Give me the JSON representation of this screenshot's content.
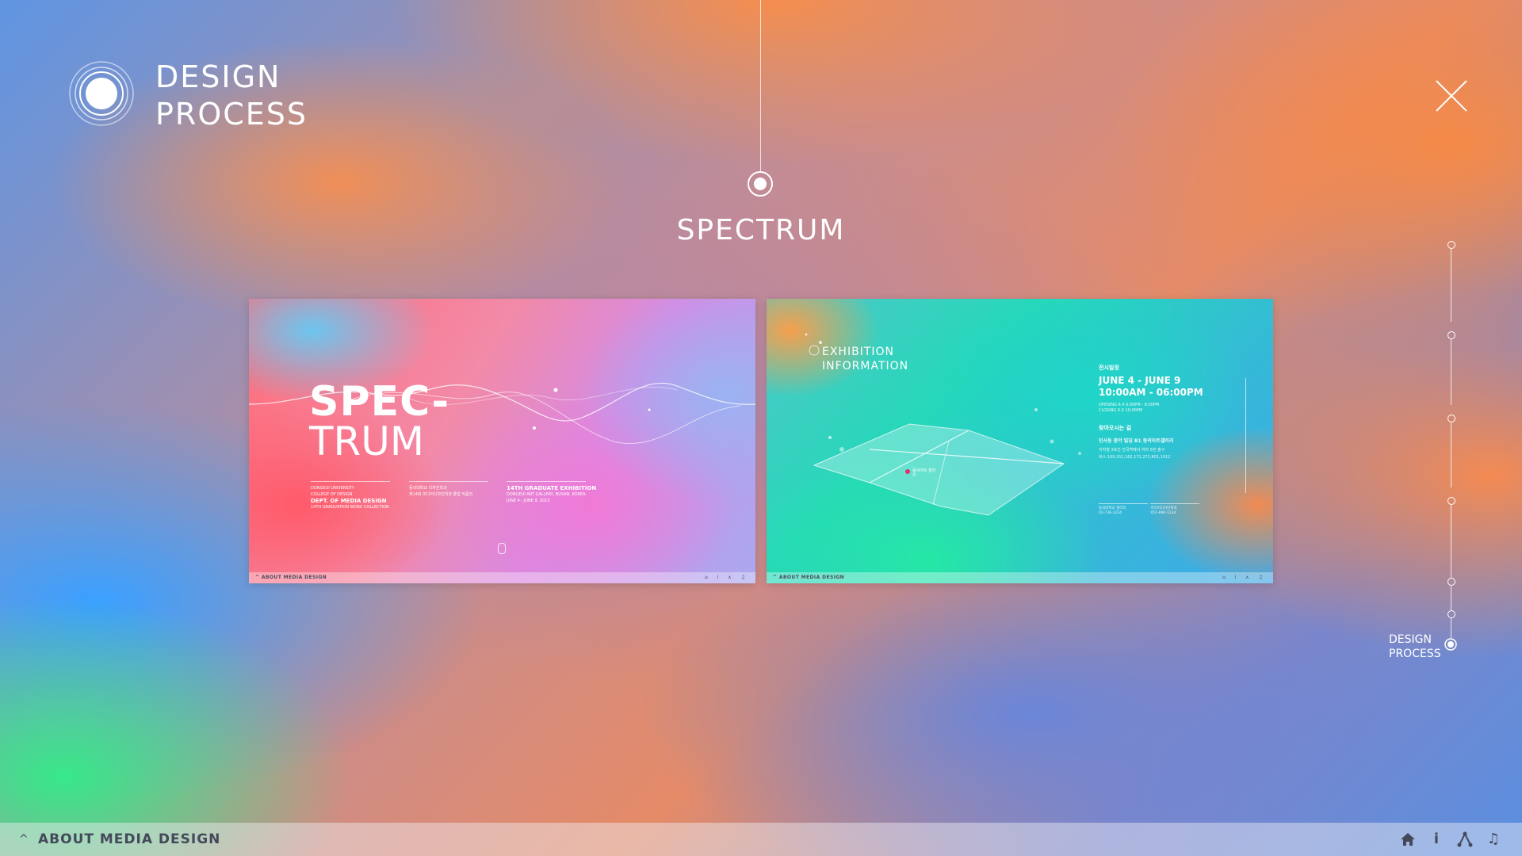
{
  "header": {
    "title_line1": "DESIGN",
    "title_line2": "PROCESS",
    "logo_icon": "ring-logo-icon",
    "close_icon": "close-icon"
  },
  "section": {
    "title": "SPECTRUM"
  },
  "cards": [
    {
      "spec": "SPEC-",
      "trum": "TRUM",
      "col1": [
        "DONGEUI UNIVERSITY",
        "COLLEGE OF DESIGN",
        "DEPT. OF MEDIA DESIGN",
        "14TH GRADUATION WORK COLLECTION"
      ],
      "col2": [
        "동의대학교 디자인학과",
        "제14회 미디어디자인학과 졸업 작품전"
      ],
      "col3": [
        "14TH GRADUATE EXHIBITION",
        "DONGEUI ART GALLERY, BUSAN, KOREA",
        "JUNE 4 - JUNE 9, 2015"
      ],
      "bar_label": "^ ABOUT MEDIA DESIGN",
      "bar_icons": "⌂ i ⋏ ♫"
    },
    {
      "title_line1": "EXHIBITION",
      "title_line2": "INFORMATION",
      "hdr1": "전시일정",
      "date1": "JUNE 4 - JUNE 9",
      "date2": "10:00AM - 06:00PM",
      "opening": "OPENING  6.4  6:00PM - 8:00PM",
      "closing": "CLOSING  6.9  10:00PM",
      "hdr2": "찾아오시는 길",
      "address": "인사동 중악 빌딩 B1 동의아트갤러리",
      "subway": "지하철   3호선 안국역에서 하차 5번 출구",
      "bus": "버스      109,151,162,171,272,601,1012",
      "contacts": [
        "동의대학교 갤러리",
        "02-736-1234",
        "미디어디자인학과",
        "051-890-1234"
      ],
      "map_label": "동의아트 갤러리",
      "bar_label": "^ ABOUT MEDIA DESIGN",
      "bar_icons": "⌂ i ⋏ ♫"
    }
  ],
  "rail": {
    "active_label_line1": "DESIGN",
    "active_label_line2": "PROCESS"
  },
  "bottom_bar": {
    "chevron": "^",
    "label": "ABOUT MEDIA DESIGN",
    "icons": [
      "home-icon",
      "info-icon",
      "share-icon",
      "music-icon"
    ],
    "info_glyph": "i",
    "music_glyph": "♫"
  }
}
